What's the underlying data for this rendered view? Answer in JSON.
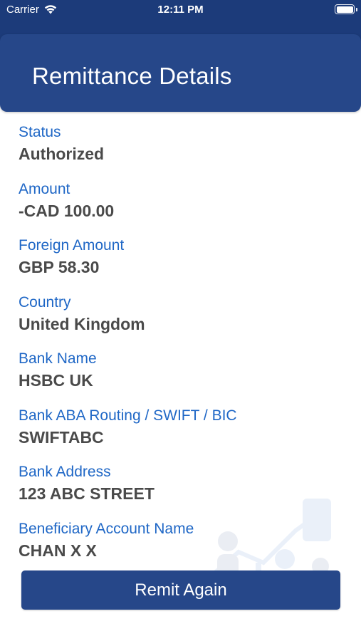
{
  "status_bar": {
    "carrier": "Carrier",
    "time": "12:11 PM",
    "wifi_icon": "wifi-icon",
    "battery_icon": "battery-icon"
  },
  "header": {
    "title": "Remittance Details"
  },
  "fields": [
    {
      "label": "Status",
      "value": "Authorized"
    },
    {
      "label": "Amount",
      "value": "-CAD 100.00"
    },
    {
      "label": "Foreign Amount",
      "value": "GBP 58.30"
    },
    {
      "label": "Country",
      "value": "United Kingdom"
    },
    {
      "label": "Bank Name",
      "value": "HSBC UK"
    },
    {
      "label": "Bank ABA Routing / SWIFT / BIC",
      "value": "SWIFTABC"
    },
    {
      "label": "Bank Address",
      "value": "123 ABC STREET"
    },
    {
      "label": "Beneficiary Account Name",
      "value": "CHAN X X"
    }
  ],
  "actions": {
    "remit_again_label": "Remit Again"
  },
  "colors": {
    "header_background": "#264789",
    "label_text": "#1f67c6",
    "value_text": "#4a4a4a",
    "button_background": "#264789"
  }
}
